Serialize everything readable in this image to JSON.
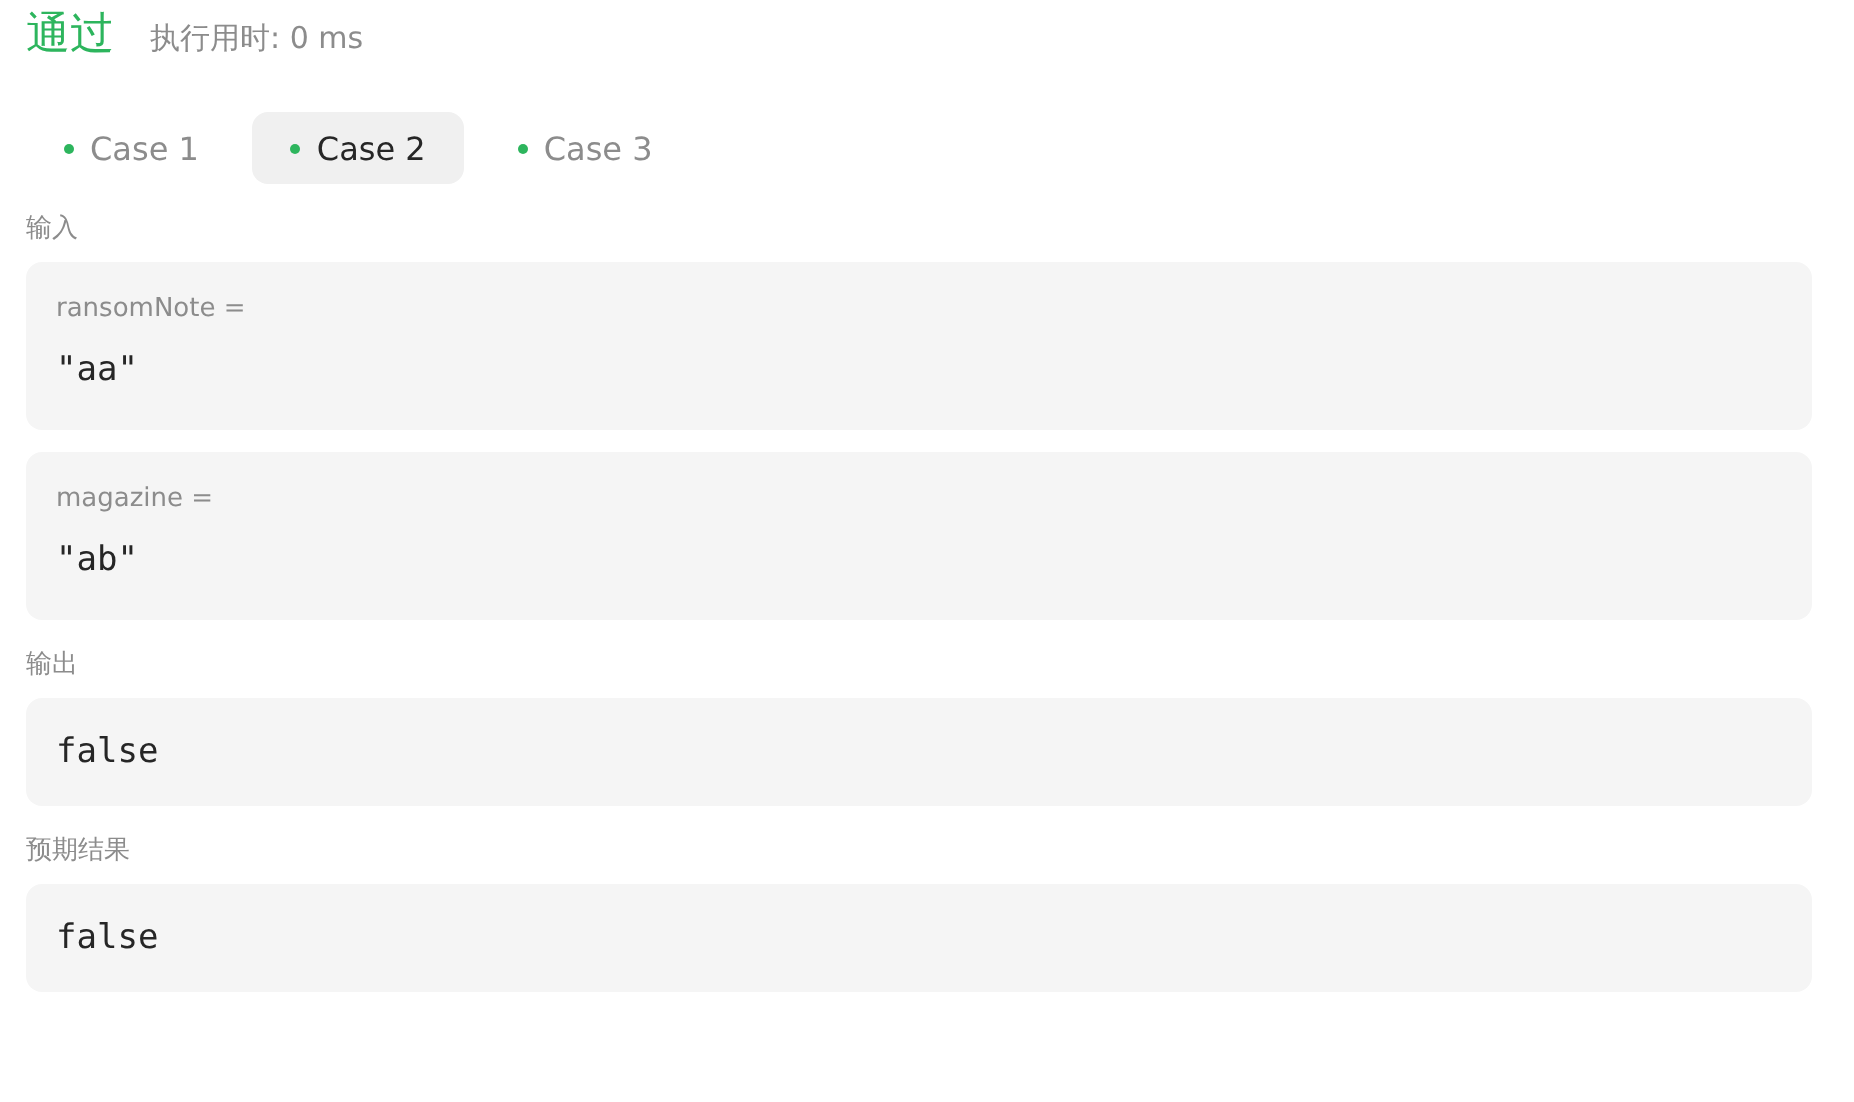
{
  "result": {
    "status": "通过",
    "runtime": "执行用时: 0 ms"
  },
  "cases": [
    {
      "label": "Case 1",
      "selected": false
    },
    {
      "label": "Case 2",
      "selected": true
    },
    {
      "label": "Case 3",
      "selected": false
    }
  ],
  "input": {
    "label": "输入",
    "params": [
      {
        "name": "ransomNote =",
        "value": "\"aa\""
      },
      {
        "name": "magazine =",
        "value": "\"ab\""
      }
    ]
  },
  "output": {
    "label": "输出",
    "value": "false"
  },
  "expected": {
    "label": "预期结果",
    "value": "false"
  }
}
